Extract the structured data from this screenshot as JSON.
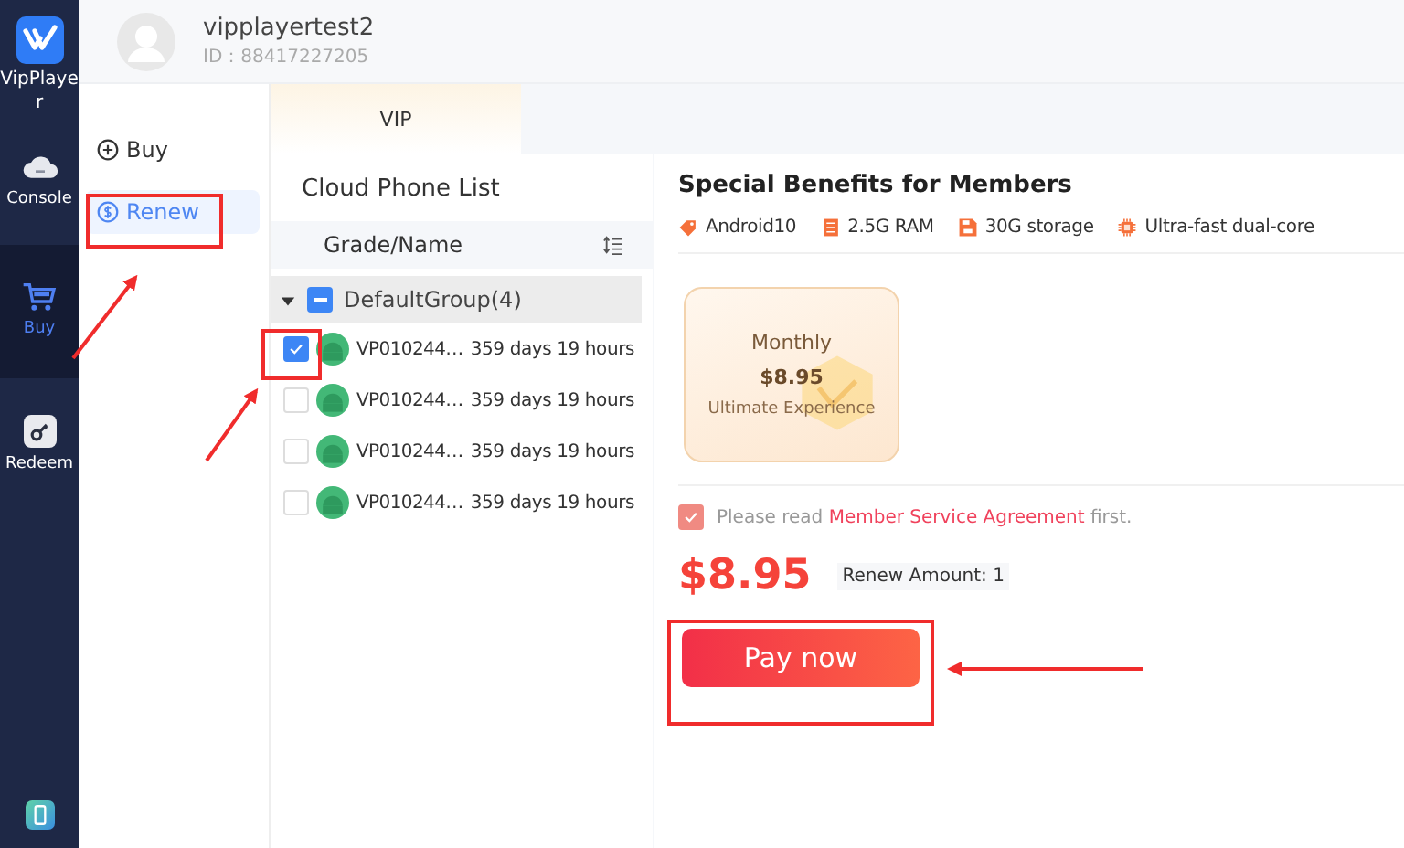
{
  "rail": {
    "app_name": "VipPlayer",
    "items": [
      {
        "kind": "console",
        "label": "Console",
        "selected": false
      },
      {
        "kind": "buy",
        "label": "Buy",
        "selected": true
      },
      {
        "kind": "redeem",
        "label": "Redeem",
        "selected": false
      }
    ]
  },
  "header": {
    "username": "vipplayertest2",
    "id": "ID：88417227205"
  },
  "submenu": [
    {
      "kind": "buy",
      "label": "Buy",
      "selected": false
    },
    {
      "kind": "renew",
      "label": "Renew",
      "selected": true
    }
  ],
  "tabs": [
    {
      "label": "VIP",
      "selected": true
    }
  ],
  "phone_list": {
    "title": "Cloud Phone List",
    "column": "Grade/Name",
    "group": {
      "name": "DefaultGroup(4)",
      "expanded": true,
      "indeterminate": true,
      "rows": [
        {
          "name": "VP010244…",
          "remaining": "359 days 19 hours",
          "checked": true
        },
        {
          "name": "VP010244…",
          "remaining": "359 days 19 hours",
          "checked": false
        },
        {
          "name": "VP010244…",
          "remaining": "359 days 19 hours",
          "checked": false
        },
        {
          "name": "VP010244…",
          "remaining": "359 days 19 hours",
          "checked": false
        }
      ]
    }
  },
  "benefits": {
    "title": "Special Benefits for Members",
    "features": [
      {
        "kind": "android",
        "label": "Android10"
      },
      {
        "kind": "ram",
        "label": "2.5G RAM"
      },
      {
        "kind": "storage",
        "label": "30G storage"
      },
      {
        "kind": "cpu",
        "label": "Ultra-fast dual-core"
      }
    ]
  },
  "plans": [
    {
      "period": "Monthly",
      "price": "$8.95",
      "subtitle": "Ultimate Experience",
      "selected": true
    }
  ],
  "agreement": {
    "checked": true,
    "before": "Please read",
    "link": "Member Service Agreement",
    "after": "first."
  },
  "total": {
    "price": "$8.95",
    "amount": "Renew Amount: 1"
  },
  "pay_button": "Pay now"
}
